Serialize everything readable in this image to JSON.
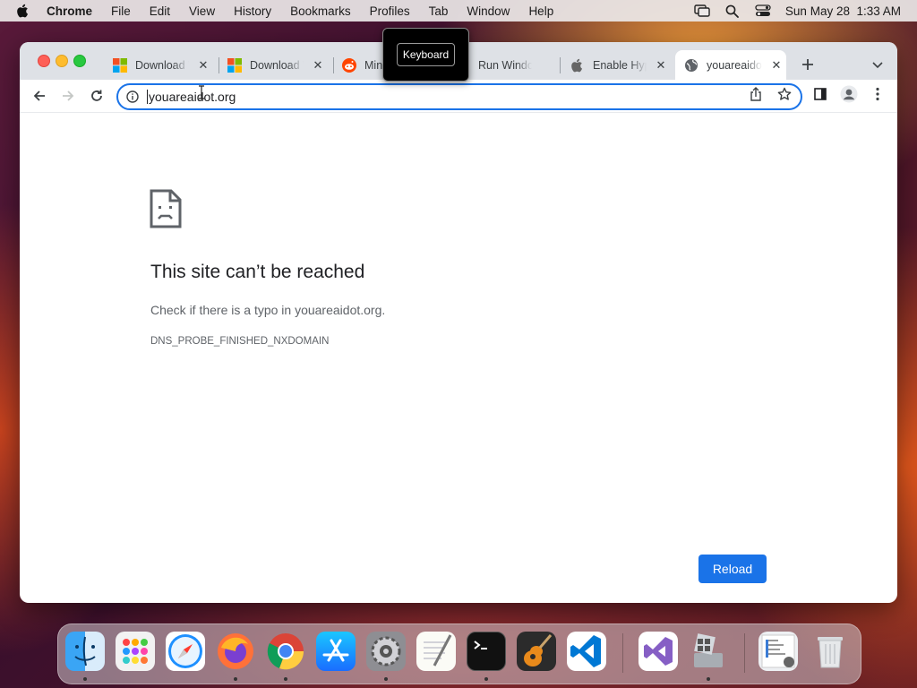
{
  "menubar": {
    "app": "Chrome",
    "items": [
      "File",
      "Edit",
      "View",
      "History",
      "Bookmarks",
      "Profiles",
      "Tab",
      "Window",
      "Help"
    ],
    "clock": "Sun May 28  1:33 AM"
  },
  "tabs": [
    {
      "label": "Download W",
      "favicon": "microsoft-logo"
    },
    {
      "label": "Download W",
      "favicon": "microsoft-logo"
    },
    {
      "label": "Min",
      "favicon": "reddit-logo"
    },
    {
      "label": "Run Windo",
      "favicon": "none"
    },
    {
      "label": "Enable Hyp",
      "favicon": "apple-logo"
    },
    {
      "label": "youareaidot",
      "favicon": "globe-icon",
      "active": true
    }
  ],
  "tooltip": {
    "label": "Keyboard"
  },
  "omnibox": {
    "url": "youareaidot.org"
  },
  "error": {
    "title": "This site can’t be reached",
    "message": "Check if there is a typo in youareaidot.org.",
    "code": "DNS_PROBE_FINISHED_NXDOMAIN",
    "reload_label": "Reload"
  },
  "dock": {
    "apps": [
      "Finder",
      "Launchpad",
      "Safari",
      "Firefox",
      "Google Chrome",
      "App Store",
      "System Preferences",
      "TextEdit",
      "Terminal",
      "GarageBand",
      "Visual Studio Code",
      "Visual Studio",
      "Boot Camp Assistant",
      "Downloads",
      "Trash"
    ]
  },
  "colors": {
    "accent": "#1a73e8",
    "tabstrip": "#dee1e6"
  }
}
